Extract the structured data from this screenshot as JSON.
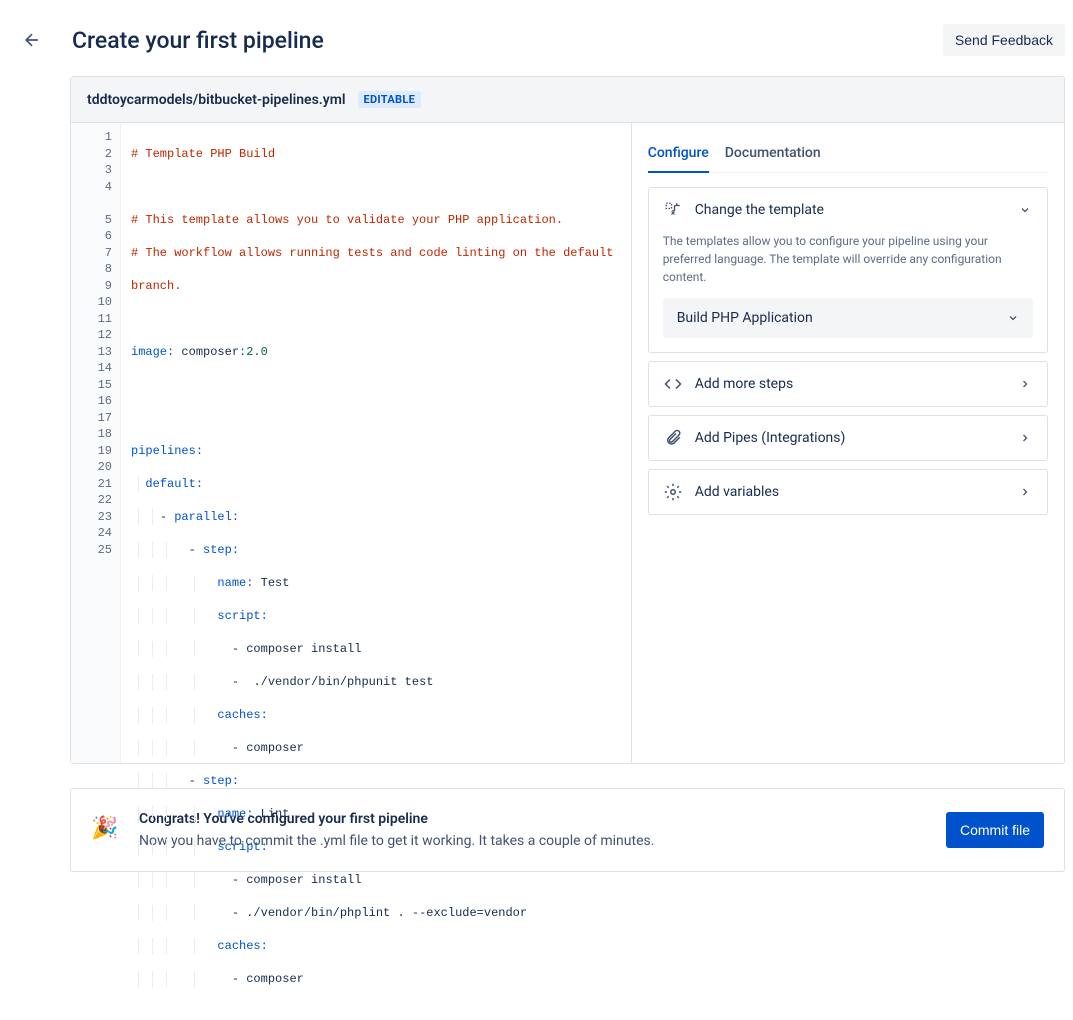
{
  "header": {
    "title": "Create your first pipeline",
    "feedback": "Send Feedback"
  },
  "file": {
    "path": "tddtoycarmodels/bitbucket-pipelines.yml",
    "badge": "EDITABLE"
  },
  "code": {
    "l1": "# Template PHP Build",
    "l2": "",
    "l3": "# This template allows you to validate your PHP application.",
    "l4a": "# The workflow allows running tests and code linting on the default ",
    "l4b": "branch.",
    "l5": "",
    "l6_key": "image",
    "l6_sep": ": ",
    "l6_val": "composer",
    "l6_colon": ":",
    "l6_num": "2.0",
    "l7": "",
    "l8": "",
    "l9_key": "pipelines",
    "l9_sep": ":",
    "l10_key": "default",
    "l10_sep": ":",
    "l11_dash": "- ",
    "l11_key": "parallel",
    "l11_sep": ":",
    "l12_dash": "- ",
    "l12_key": "step",
    "l12_sep": ":",
    "l13_key": "name",
    "l13_sep": ": ",
    "l13_val": "Test",
    "l14_key": "script",
    "l14_sep": ":",
    "l15_dash": "- ",
    "l15_val": "composer install",
    "l16_dash": "-  ",
    "l16_val": "./vendor/bin/phpunit test",
    "l17_key": "caches",
    "l17_sep": ":",
    "l18_dash": "- ",
    "l18_val": "composer",
    "l19_dash": "- ",
    "l19_key": "step",
    "l19_sep": ":",
    "l20_key": "name",
    "l20_sep": ": ",
    "l20_val": "Lint",
    "l21_key": "script",
    "l21_sep": ":",
    "l22_dash": "- ",
    "l22_val": "composer install",
    "l23_dash": "- ",
    "l23_val": "./vendor/bin/phplint . --exclude=vendor",
    "l24_key": "caches",
    "l24_sep": ":",
    "l25_dash": "- ",
    "l25_val": "composer"
  },
  "lines": [
    "1",
    "2",
    "3",
    "4",
    "5",
    "6",
    "7",
    "8",
    "9",
    "10",
    "11",
    "12",
    "13",
    "14",
    "15",
    "16",
    "17",
    "18",
    "19",
    "20",
    "21",
    "22",
    "23",
    "24",
    "25"
  ],
  "tabs": {
    "configure": "Configure",
    "documentation": "Documentation"
  },
  "cards": {
    "template": {
      "title": "Change the template",
      "desc": "The templates allow you to configure your pipeline using your preferred language. The template will override any configuration content.",
      "selected": "Build PHP Application"
    },
    "steps": {
      "title": "Add more steps"
    },
    "pipes": {
      "title": "Add Pipes (Integrations)"
    },
    "vars": {
      "title": "Add variables"
    }
  },
  "footer": {
    "title": "Congrats! You've configured your first pipeline",
    "sub": "Now you have to commit the .yml file to get it working. It takes a couple of minutes.",
    "button": "Commit file"
  }
}
